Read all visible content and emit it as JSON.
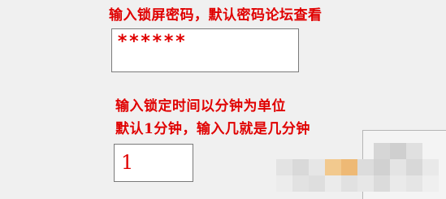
{
  "lock_password": {
    "label": "输入锁屏密码，默认密码论坛查看",
    "masked_value": "******"
  },
  "lock_time": {
    "label_line1": "输入锁定时间以分钟为单位",
    "label_line2": "默认1分钟，输入几就是几分钟",
    "value": "1"
  },
  "colors": {
    "label_text": "#e00000",
    "window_background": "#f0f0f0",
    "input_background": "#ffffff",
    "input_border": "#7a7a7a"
  }
}
